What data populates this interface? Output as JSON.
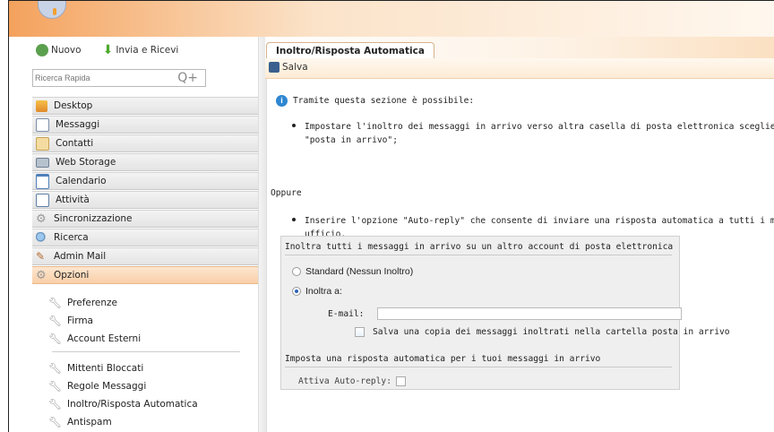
{
  "toolbar": {
    "new_label": "Nuovo",
    "send_receive_label": "Invia e Ricevi"
  },
  "search": {
    "placeholder": "Ricerca Rapida",
    "icon_glyph": "Q+"
  },
  "nav": {
    "items": [
      {
        "label": "Desktop",
        "icon": "home-icon"
      },
      {
        "label": "Messaggi",
        "icon": "mail-icon"
      },
      {
        "label": "Contatti",
        "icon": "contacts-icon"
      },
      {
        "label": "Web Storage",
        "icon": "storage-icon"
      },
      {
        "label": "Calendario",
        "icon": "calendar-icon"
      },
      {
        "label": "Attività",
        "icon": "tasks-icon"
      },
      {
        "label": "Sincronizzazione",
        "icon": "sync-gear-icon"
      },
      {
        "label": "Ricerca",
        "icon": "search-icon"
      },
      {
        "label": "Admin Mail",
        "icon": "admin-tools-icon"
      },
      {
        "label": "Opzioni",
        "icon": "options-gear-icon"
      }
    ],
    "active": "Opzioni"
  },
  "options_menu": {
    "group1": [
      "Preferenze",
      "Firma",
      "Account Esterni"
    ],
    "group2": [
      "Mittenti Bloccati",
      "Regole Messaggi",
      "Inoltro/Risposta Automatica",
      "Antispam"
    ]
  },
  "tab": {
    "title": "Inoltro/Risposta Automatica"
  },
  "actions": {
    "save_label": "Salva"
  },
  "content": {
    "intro": "Tramite questa sezione è possibile:",
    "bullet1_line1": "Impostare l'inoltro dei messaggi in arrivo verso altra casella di posta elettronica scegliendo se sal",
    "bullet1_line2": "\"posta in arrivo\";",
    "oppure": "Oppure",
    "bullet2_line1": "Inserire l'opzione \"Auto-reply\" che consente di inviare una risposta automatica a tutti i messaggi i",
    "bullet2_line2": "ufficio."
  },
  "forward_box": {
    "title": "Inoltra tutti i messaggi in arrivo su un altro account di posta elettronica",
    "option_standard": "Standard (Nessun Inoltro)",
    "option_forward": "Inoltra a:",
    "selected_option": "Inoltra a:",
    "email_label": "E-mail:",
    "email_value": "",
    "copy_checkbox_label": "Salva una copia dei messaggi inoltrati nella cartella posta in arrivo",
    "copy_checked": false,
    "autoreply_title": "Imposta una risposta automatica per i tuoi messaggi in arrivo",
    "autoreply_label": "Attiva Auto-reply:",
    "autoreply_checked": false
  },
  "colors": {
    "accent_orange": "#f4a25d",
    "active_nav": "#f9cfa8",
    "info_blue": "#2e86d1"
  }
}
